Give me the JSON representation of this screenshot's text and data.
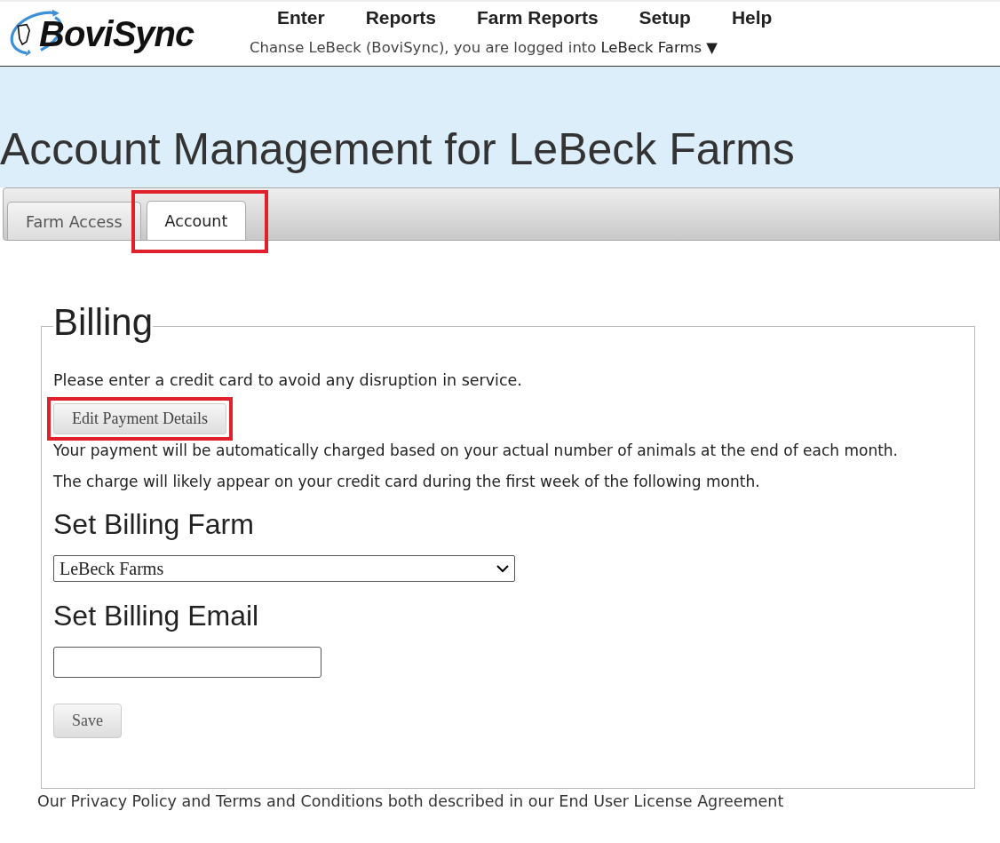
{
  "header": {
    "logo_text": "BoviSync",
    "nav": [
      "Enter",
      "Reports",
      "Farm Reports",
      "Setup",
      "Help"
    ],
    "user_line": "Chanse LeBeck (BoviSync), you are logged into",
    "farm_menu": "LeBeck Farms",
    "farm_menu_caret": "▼"
  },
  "page_title": "Account Management for LeBeck Farms",
  "tabs": [
    {
      "label": "Farm Access",
      "selected": false,
      "highlighted": false
    },
    {
      "label": "Account",
      "selected": true,
      "highlighted": true
    }
  ],
  "billing": {
    "legend": "Billing",
    "notice": "Please enter a credit card to avoid any disruption in service.",
    "edit_button": {
      "label": "Edit Payment Details",
      "highlighted": true
    },
    "info": [
      "Your payment will be automatically charged based on your actual number of animals at the end of each month.",
      "The charge will likely appear on your credit card during the first week of the following month."
    ],
    "farm_heading": "Set Billing Farm",
    "farm_select": "LeBeck Farms",
    "email_heading": "Set Billing Email",
    "save_button": "Save"
  },
  "footer": "Our Privacy Policy and Terms and Conditions both described in our End User License Agreement"
}
